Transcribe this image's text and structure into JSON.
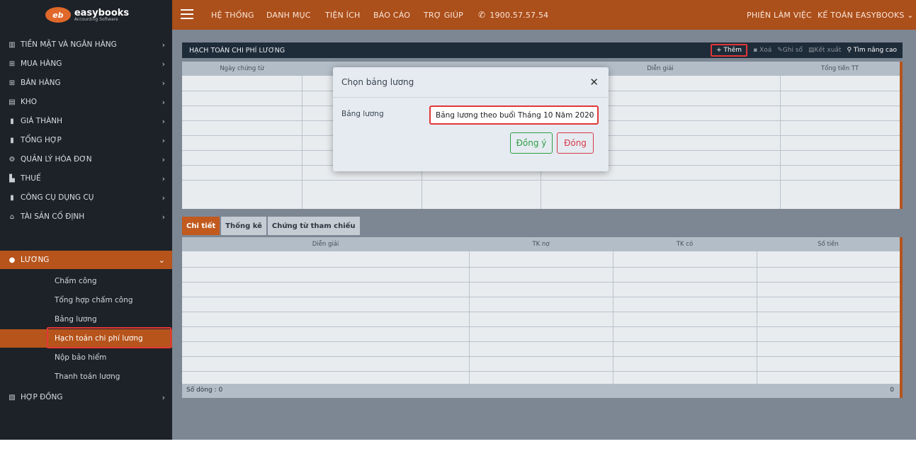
{
  "logo": {
    "title": "easybooks",
    "subtitle": "Accounting Software",
    "mark": "eb"
  },
  "topnav": {
    "items": [
      "HỆ THỐNG",
      "DANH MỤC",
      "TIỆN ÍCH",
      "BÁO CÁO",
      "TRỢ GIÚP"
    ],
    "phone": "1900.57.57.54",
    "session": "PHIÊN LÀM VIỆC",
    "user": "KẾ TOÁN EASYBOOKS ⌄"
  },
  "sidebar": {
    "items": [
      {
        "label": "TIỀN MẶT VÀ NGÂN HÀNG",
        "icon": "bank-icon"
      },
      {
        "label": "MUA HÀNG",
        "icon": "cart-icon"
      },
      {
        "label": "BÁN HÀNG",
        "icon": "cart-icon"
      },
      {
        "label": "KHO",
        "icon": "warehouse-icon"
      },
      {
        "label": "GIÁ THÀNH",
        "icon": "document-icon"
      },
      {
        "label": "TỔNG HỢP",
        "icon": "document-icon"
      },
      {
        "label": "QUẢN LÝ HÓA ĐƠN",
        "icon": "gear-icon"
      },
      {
        "label": "THUẾ",
        "icon": "tax-icon"
      },
      {
        "label": "CÔNG CỤ DỤNG CỤ",
        "icon": "document-icon"
      },
      {
        "label": "TÀI SẢN CỐ ĐỊNH",
        "icon": "home-icon"
      },
      {
        "label": "LƯƠNG",
        "icon": "user-icon"
      },
      {
        "label": "HỢP ĐỒNG",
        "icon": "contract-icon"
      }
    ],
    "luong_sub": [
      "Chấm công",
      "Tổng hợp chấm công",
      "Bảng lương",
      "Hạch toán chi phí lương",
      "Nộp bảo hiểm",
      "Thanh toán lương"
    ]
  },
  "content": {
    "title": "HẠCH TOÁN CHI PHÍ LƯƠNG",
    "toolbar": {
      "add": "+ Thêm",
      "delete": "Xoá",
      "post": "Ghi sổ",
      "export": "Kết xuất",
      "search": "Tìm nâng cao"
    },
    "top_grid": {
      "columns": [
        "Ngày chứng từ",
        "",
        "",
        "",
        "Diễn giải",
        "Tổng tiền TT"
      ]
    },
    "tabs": [
      "Chi tiết",
      "Thống kê",
      "Chứng từ tham chiếu"
    ],
    "bottom_grid": {
      "columns": [
        "Diễn giải",
        "TK nợ",
        "TK có",
        "Số tiền"
      ],
      "footer_label": "Số dòng : 0",
      "footer_total": "0"
    }
  },
  "modal": {
    "title": "Chọn bảng lương",
    "field_label": "Bảng lương",
    "select_value": "Bảng lương theo buổi Tháng 10 Năm 2020",
    "ok": "Đồng ý",
    "close": "Đóng"
  },
  "colors": {
    "accent": "#ab4f1b",
    "sidebar": "#1d2228",
    "highlight": "#e23737"
  }
}
